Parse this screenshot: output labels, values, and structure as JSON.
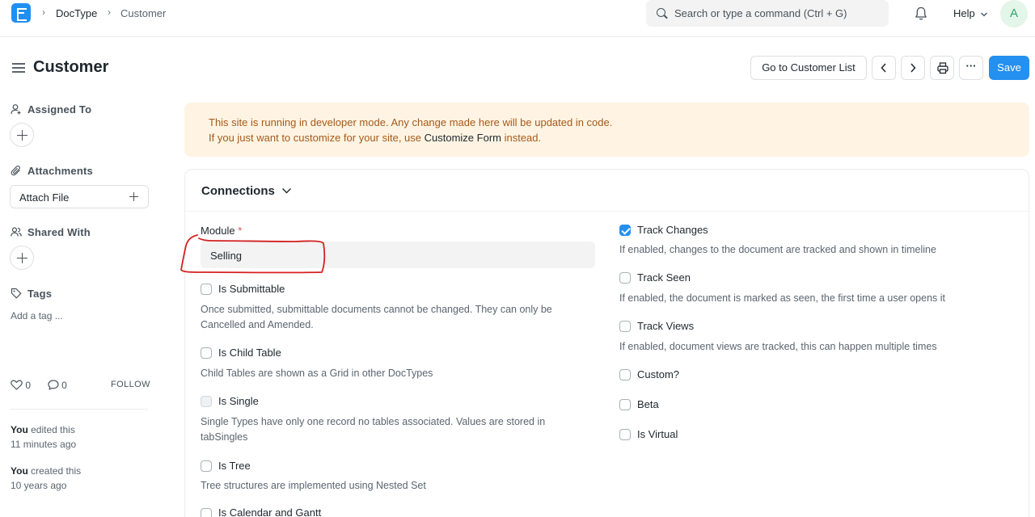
{
  "navbar": {
    "breadcrumbs": [
      "DocType",
      "Customer"
    ],
    "search_placeholder": "Search or type a command (Ctrl + G)",
    "help_label": "Help",
    "avatar_initial": "A"
  },
  "page": {
    "title": "Customer",
    "go_to_list_label": "Go to Customer List",
    "more_label": "···",
    "save_label": "Save"
  },
  "sidebar": {
    "assigned_to": "Assigned To",
    "attachments": "Attachments",
    "attach_file": "Attach File",
    "shared_with": "Shared With",
    "tags": "Tags",
    "add_tag": "Add a tag ...",
    "likes": "0",
    "comments": "0",
    "follow": "FOLLOW",
    "activity": [
      {
        "who": "You",
        "action": " edited this",
        "when": "11 minutes ago"
      },
      {
        "who": "You",
        "action": " created this",
        "when": "10 years ago"
      }
    ]
  },
  "alert": {
    "line1": "This site is running in developer mode. Any change made here will be updated in code.",
    "line2_prefix": "If you just want to customize for your site, use ",
    "line2_link": "Customize Form",
    "line2_suffix": " instead."
  },
  "section": {
    "title": "Connections",
    "module_label": "Module",
    "module_required": "*",
    "module_value": "Selling",
    "left_fields": [
      {
        "label": "Is Submittable",
        "checked": false,
        "desc": [
          "Once submitted, submittable documents cannot be changed. They can only be",
          "Cancelled and Amended."
        ]
      },
      {
        "label": "Is Child Table",
        "checked": false,
        "desc": [
          "Child Tables are shown as a Grid in other DocTypes"
        ]
      },
      {
        "label": "Is Single",
        "checked": false,
        "desc": [
          "Single Types have only one record no tables associated. Values are stored in",
          "tabSingles"
        ]
      },
      {
        "label": "Is Tree",
        "checked": false,
        "desc": [
          "Tree structures are implemented using Nested Set"
        ]
      },
      {
        "label": "Is Calendar and Gantt",
        "checked": false,
        "desc": []
      }
    ],
    "right_fields": [
      {
        "label": "Track Changes",
        "checked": true,
        "desc": [
          "If enabled, changes to the document are tracked and shown in timeline"
        ]
      },
      {
        "label": "Track Seen",
        "checked": false,
        "desc": [
          "If enabled, the document is marked as seen, the first time a user opens it"
        ]
      },
      {
        "label": "Track Views",
        "checked": false,
        "desc": [
          "If enabled, document views are tracked, this can happen multiple times"
        ]
      },
      {
        "label": "Custom?",
        "checked": false,
        "desc": []
      },
      {
        "label": "Beta",
        "checked": false,
        "desc": []
      },
      {
        "label": "Is Virtual",
        "checked": false,
        "desc": []
      }
    ]
  },
  "colors": {
    "primary": "#2490ef",
    "alert_bg": "#fff4e3",
    "alert_text": "#a5591a",
    "annotation": "#d42020"
  }
}
